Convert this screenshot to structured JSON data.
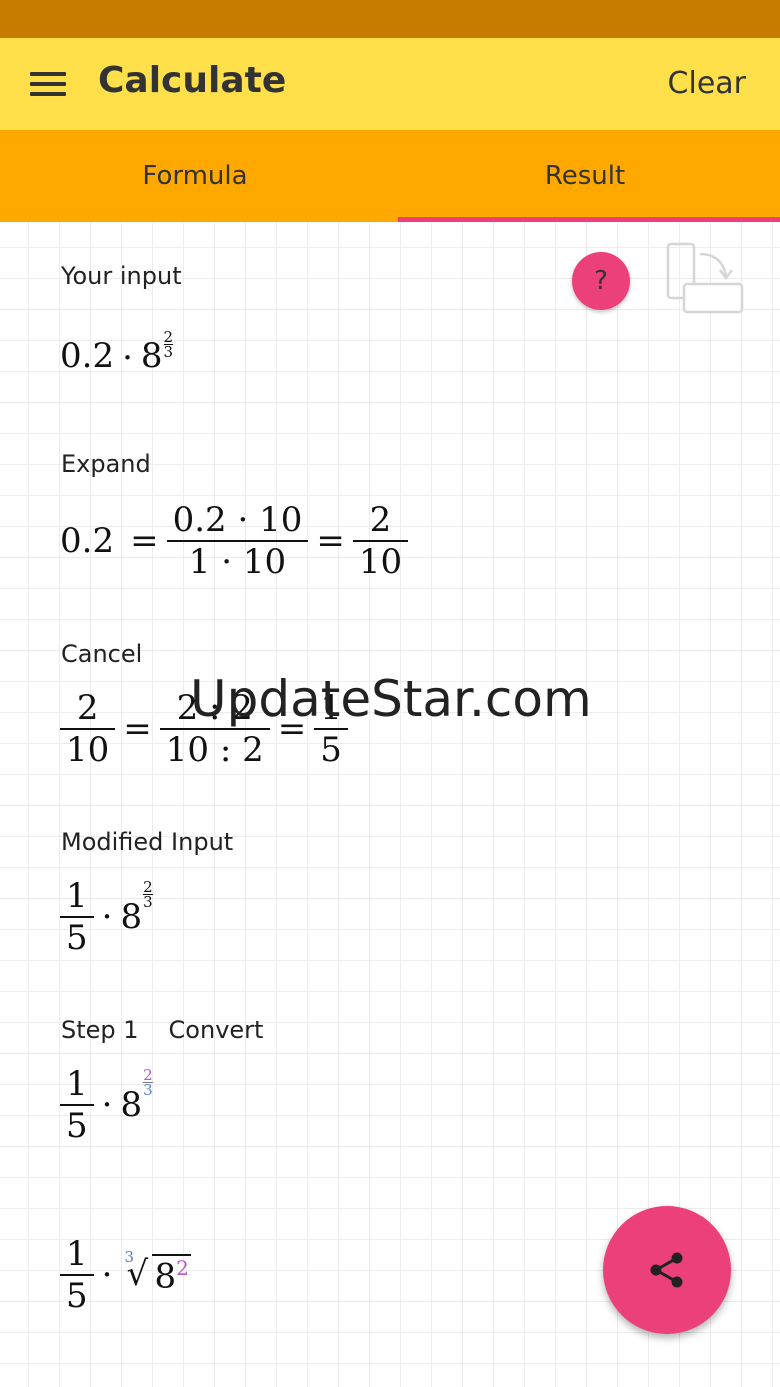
{
  "appbar": {
    "title": "Calculate",
    "clear_label": "Clear",
    "menu_icon": "menu-icon"
  },
  "tabs": [
    {
      "label": "Formula",
      "active": false
    },
    {
      "label": "Result",
      "active": true
    }
  ],
  "colors": {
    "status_bar": "#C77C00",
    "app_bar": "#FFE04A",
    "tab_bar": "#FFA800",
    "accent": "#EC407A"
  },
  "help": {
    "label": "?",
    "icon": "help-icon"
  },
  "rotate": {
    "icon": "rotate-screen-icon"
  },
  "share": {
    "icon": "share-icon"
  },
  "sections": {
    "your_input": {
      "label": "Your input",
      "base_coeff": "0.2",
      "dot": "·",
      "base": "8",
      "exp_num": "2",
      "exp_den": "3"
    },
    "expand": {
      "label": "Expand",
      "lhs": "0.2",
      "eq": "=",
      "frac1_num": "0.2 · 10",
      "frac1_den": "1 · 10",
      "frac2_num": "2",
      "frac2_den": "10"
    },
    "cancel": {
      "label": "Cancel",
      "frac1_num": "2",
      "frac1_den": "10",
      "frac2_num": "2 : 2",
      "frac2_den": "10 : 2",
      "frac3_num": "1",
      "frac3_den": "5",
      "eq": "="
    },
    "modified_input": {
      "label": "Modified Input",
      "num": "1",
      "den": "5",
      "dot": "·",
      "base": "8",
      "exp_num": "2",
      "exp_den": "3"
    },
    "step1": {
      "label": "Step 1",
      "action": "Convert",
      "num": "1",
      "den": "5",
      "dot": "·",
      "base": "8",
      "exp_num": "2",
      "exp_den": "3"
    },
    "step1_result": {
      "num": "1",
      "den": "5",
      "dot": "·",
      "root_index": "3",
      "radicand": "8",
      "power": "2"
    }
  },
  "watermark": "UpdateStar.com"
}
